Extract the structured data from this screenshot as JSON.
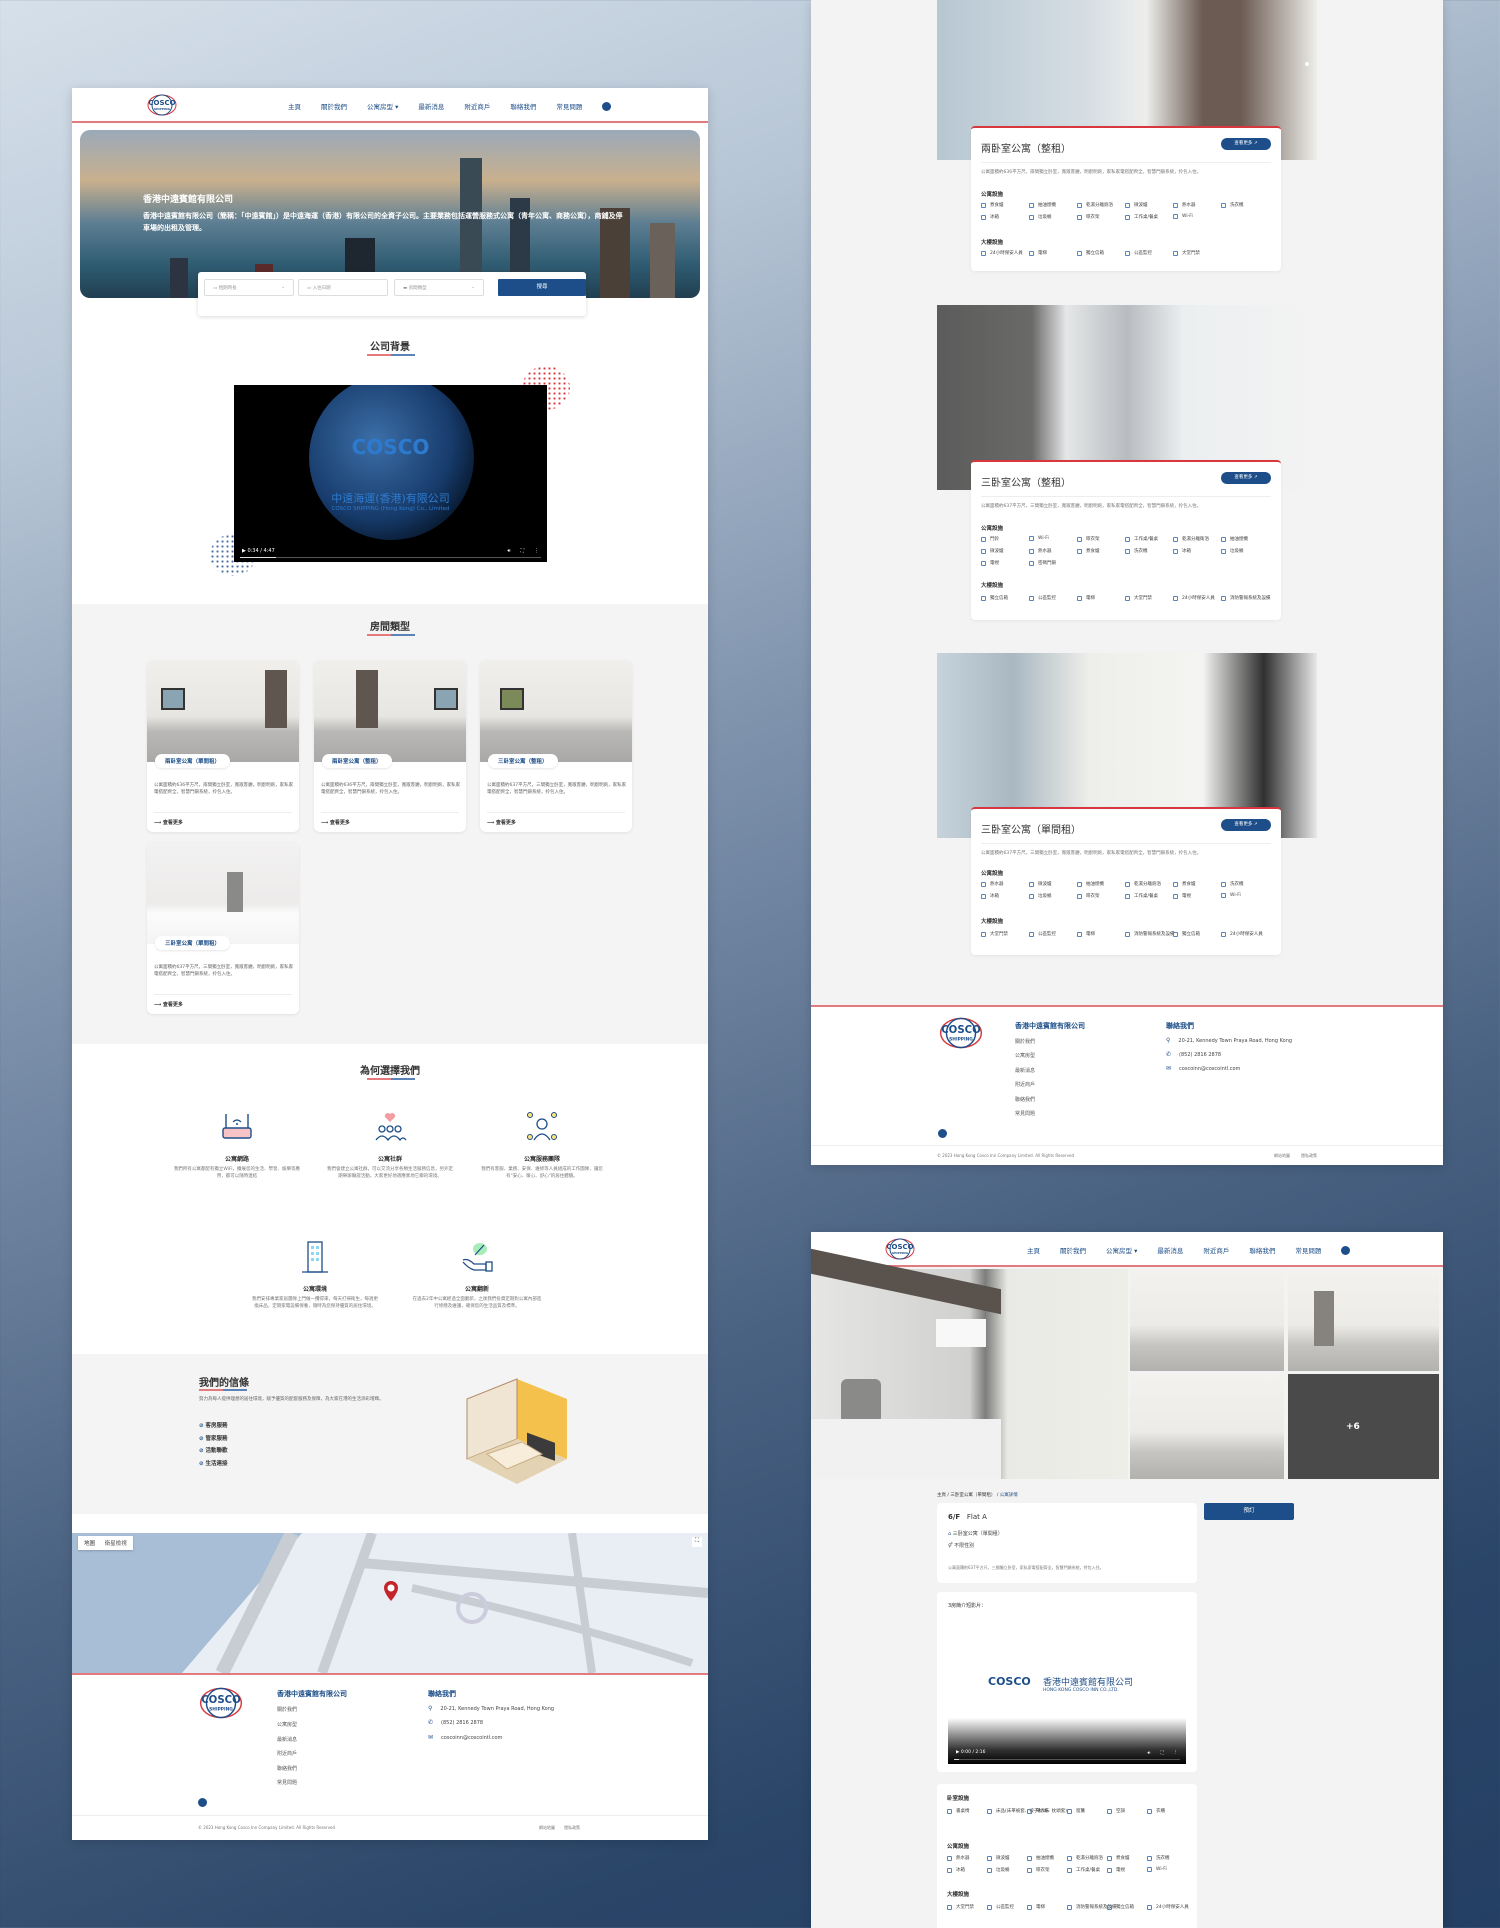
{
  "brand": {
    "logo_text_top": "COSCO",
    "logo_text_bottom": "SHIPPING",
    "colors": {
      "primary": "#1d4e89",
      "accent_red": "#e27a7e",
      "bg_grey": "#f4f4f4"
    }
  },
  "nav": {
    "items": [
      "主頁",
      "關於我們",
      "公寓房型 ▾",
      "最新消息",
      "附近商戶",
      "聯絡我們",
      "常見問題"
    ],
    "user_icon": "user-circle-icon"
  },
  "hero": {
    "title": "香港中遠賓館有限公司",
    "description": "香港中遠賓館有限公司（簡稱：「中遠賓館」）是中遠海運（香港）有限公司的全資子公司。主要業務包括運營服務式公寓（青年公寓、商務公寓），商鋪及停車場的出租及管理。"
  },
  "search": {
    "lease_placeholder": "租期時長",
    "date_placeholder": "入住日期",
    "room_placeholder": "房間類型",
    "button": "搜尋"
  },
  "company_bg": {
    "title": "公司背景",
    "video_caption_cn": "中遠海運(香港)有限公司",
    "video_caption_en": "COSCO SHIPPING (Hong Kong) Co., Limited",
    "video_time": "0:34 / 4:47",
    "video_progress": 0.12
  },
  "room_types": {
    "title": "房間類型",
    "more_label": "查看更多",
    "cards": [
      {
        "name": "兩卧室公寓（單間租）",
        "desc": "公寓面積約636平方尺，兩間獨立卧室，寬敞客廳，明廚明廁，家私家電搭配齊全，智慧門鎖系統，拎包入住。"
      },
      {
        "name": "兩卧室公寓（整租）",
        "desc": "公寓面積約636平方尺，兩間獨立卧室，寬敞客廳，明廚明廁，家私家電搭配齊全，智慧門鎖系統，拎包入住。"
      },
      {
        "name": "三卧室公寓（整租）",
        "desc": "公寓面積約637平方尺，三間獨立卧室，寬敞客廳，明廚明廁，家私家電搭配齊全，智慧門鎖系統，拎包入住。"
      },
      {
        "name": "三卧室公寓（單間租）",
        "desc": "公寓面積約637平方尺，三間獨立卧室，寬敞客廳，明廚明廁，家私家電搭配齊全，智慧門鎖系統，拎包入住。"
      }
    ]
  },
  "why_us": {
    "title": "為何選擇我們",
    "features": [
      {
        "icon": "wifi-router-icon",
        "title": "公寓網路",
        "desc": "我們所有公寓都配有獨立WiFi，擴展您的生活、學習、娛樂等應用，都可以隨時連結"
      },
      {
        "icon": "community-heart-icon",
        "title": "公寓社群",
        "desc": "我們會建立公寓社群，可以交流分享各類生活服務信息，另外定期舉辦聯誼活動，大家更好地適應異地它鄉的環境。"
      },
      {
        "icon": "service-team-icon",
        "title": "公寓服務團隊",
        "desc": "我們有客服、業務、安保、維修等人員組成的工作團隊，讓您有\"安心、暖心、舒心\"的居住體驗。"
      },
      {
        "icon": "building-icon",
        "title": "公寓環境",
        "desc": "我們安排專業家居團隊上門做一攬得來，每天打掃衛生，每週更換床品，定期家電設備保養，隨時為您保持優質的居住環境。"
      },
      {
        "icon": "eco-hand-icon",
        "title": "公寓翻新",
        "desc": "在過去2年中公寓經過全面翻新，之後我們投資定期對公寓內部進行修繕及維護，確保您的生活品質及標準。"
      }
    ]
  },
  "belief": {
    "title": "我們的信條",
    "desc": "努力為每人提供理想的居住環境，賦予優質的配套服務及保障，為大家在港的生活添彩增輝。",
    "items": [
      "客房服務",
      "管家服務",
      "活動聯歡",
      "生活連接"
    ]
  },
  "map": {
    "tab_map": "地圖",
    "tab_satellite": "衛星檢視"
  },
  "footer": {
    "company_title": "香港中遠賓館有限公司",
    "links": [
      "關於我們",
      "公寓房型",
      "最新消息",
      "附近商戶",
      "聯絡我們",
      "常見問題"
    ],
    "contact_title": "聯絡我們",
    "address": "20-21, Kennedy Town Praya Road, Hong Kong",
    "phone": "(852) 2816 2878",
    "email": "coscoinn@coscointl.com",
    "copyright": "© 2023 Hong Kong Cosco Inn Company Limited. All Rights Reserved",
    "bottom_links": [
      "網站地圖",
      "隱私政策"
    ]
  },
  "listing": {
    "more_label": "查看更多",
    "apt_fac_label": "公寓設施",
    "bldg_fac_label": "大樓設施",
    "items": [
      {
        "name": "兩卧室公寓（整租）",
        "desc": "公寓面積約636平方尺，兩間獨立卧室，寬敞客廳，明廚明廁，家私家電搭配齊全，智慧門鎖系統，拎包入住。",
        "apt": [
          "煮食爐",
          "抽油煙機",
          "乾濕分離廁浴",
          "微波爐",
          "熱水器",
          "洗衣機",
          "冰箱",
          "垃圾桶",
          "晾衣架",
          "工作桌/餐桌",
          "Wi-Fi"
        ],
        "bldg": [
          "24小時保安人員",
          "電梯",
          "獨立信箱",
          "公區監控",
          "大堂門禁"
        ]
      },
      {
        "name": "三卧室公寓（整租）",
        "desc": "公寓面積約637平方尺，三間獨立卧室，寬敞客廳，明廚明廁，家私家電搭配齊全，智慧門鎖系統，拎包入住。",
        "apt": [
          "門鈴",
          "Wi-Fi",
          "晾衣架",
          "工作桌/餐桌",
          "乾濕分離衛浴",
          "抽油煙機",
          "微波爐",
          "熱水器",
          "煮食爐",
          "洗衣機",
          "冰箱",
          "垃圾桶",
          "電視",
          "密碼門鎖"
        ],
        "bldg": [
          "獨立信箱",
          "公區監控",
          "電梯",
          "大堂門禁",
          "24小時保安人員",
          "消防警報系統及設備"
        ]
      },
      {
        "name": "三卧室公寓（單間租）",
        "desc": "公寓面積約637平方尺，三間獨立卧室，寬敞客廳，明廚明廁，家私家電搭配齊全，智慧門鎖系統，拎包入住。",
        "apt": [
          "熱水器",
          "微波爐",
          "抽油煙機",
          "乾濕分離廁浴",
          "煮食爐",
          "洗衣機",
          "冰箱",
          "垃圾桶",
          "晾衣架",
          "工作桌/餐桌",
          "電視",
          "Wi-Fi"
        ],
        "bldg": [
          "大堂門禁",
          "公區監控",
          "電梯",
          "消防警報系統及設備",
          "獨立信箱",
          "24小時保安人員"
        ]
      }
    ]
  },
  "detail": {
    "gallery_more": "+6",
    "breadcrumb": [
      "主頁",
      "三卧室公寓（單間租）",
      "公寓詳情"
    ],
    "floor": "6/F",
    "flat": "Flat A",
    "room_type": "三卧室公寓（單間租）",
    "gender": "不限性別",
    "desc": "公寓面積約637平方尺，三間獨立卧室，家私家電搭配齊全，智慧門鎖系統，拎包入住。",
    "book_button": "預訂",
    "video_label": "3房簡介短影片：",
    "video_logo_cn": "香港中遠賓館有限公司",
    "video_logo_en": "HONG KONG COSCO INN CO.,LTD.",
    "video_time": "0:00 / 2:16",
    "room_fac_label": "卧室設施",
    "room_fac": [
      "書桌椅",
      "床品(床單被套、被子枕頭、枕頭套)",
      "單人床",
      "窗簾",
      "空調",
      "衣櫃"
    ],
    "apt_fac_label": "公寓設施",
    "apt_fac": [
      "熱水器",
      "微波爐",
      "抽油煙機",
      "乾濕分離廁浴",
      "煮食爐",
      "洗衣機",
      "冰箱",
      "垃圾桶",
      "晾衣架",
      "工作桌/餐桌",
      "電視",
      "Wi-Fi"
    ],
    "bldg_fac_label": "大樓設施",
    "bldg_fac": [
      "大堂門禁",
      "公區監控",
      "電梯",
      "消防警報系統及設備",
      "獨立信箱",
      "24小時保安人員"
    ]
  }
}
